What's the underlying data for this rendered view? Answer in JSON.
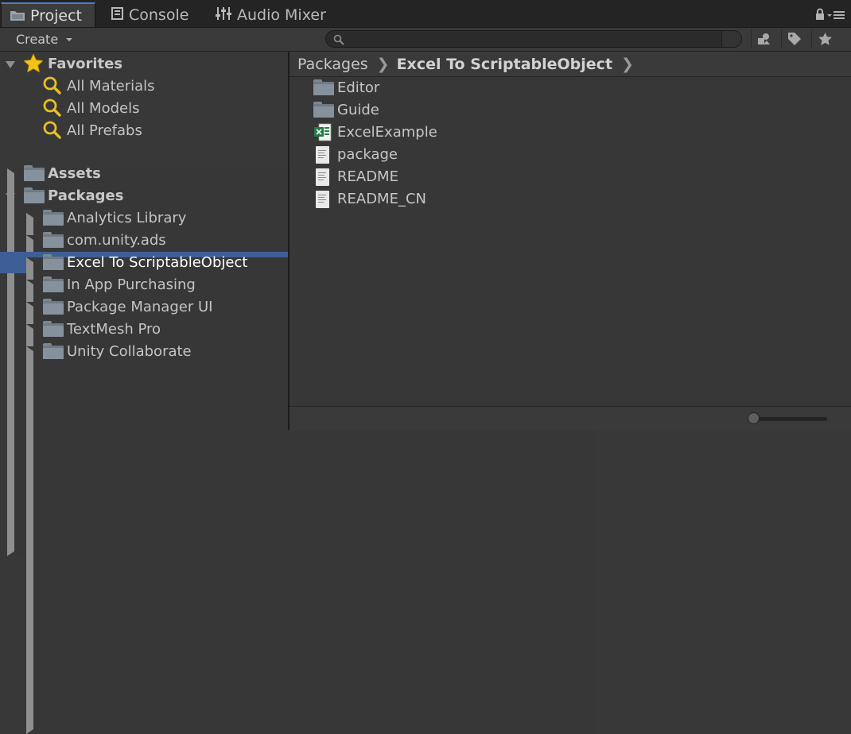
{
  "tabs": [
    {
      "label": "Project",
      "icon": "folder-icon",
      "active": true
    },
    {
      "label": "Console",
      "icon": "console-icon",
      "active": false
    },
    {
      "label": "Audio Mixer",
      "icon": "mixer-icon",
      "active": false
    }
  ],
  "toolbar": {
    "create_label": "Create",
    "search_placeholder": "",
    "icons": [
      "filter-by-type-icon",
      "filter-by-label-icon",
      "favorite-star-icon"
    ]
  },
  "favorites": {
    "label": "Favorites",
    "items": [
      "All Materials",
      "All Models",
      "All Prefabs"
    ]
  },
  "tree": {
    "assets_label": "Assets",
    "packages_label": "Packages",
    "packages": [
      "Analytics Library",
      "com.unity.ads",
      "Excel To ScriptableObject",
      "In App Purchasing",
      "Package Manager UI",
      "TextMesh Pro",
      "Unity Collaborate"
    ],
    "selected": "Excel To ScriptableObject"
  },
  "breadcrumb": [
    "Packages",
    "Excel To ScriptableObject"
  ],
  "files": [
    {
      "name": "Editor",
      "icon": "folder-icon"
    },
    {
      "name": "Guide",
      "icon": "folder-icon"
    },
    {
      "name": "ExcelExample",
      "icon": "excel-file-icon"
    },
    {
      "name": "package",
      "icon": "text-file-icon"
    },
    {
      "name": "README",
      "icon": "text-file-icon"
    },
    {
      "name": "README_CN",
      "icon": "text-file-icon"
    }
  ],
  "zoom": {
    "level": 0.0
  },
  "colors": {
    "selection": "#3e5f96",
    "active_tab_accent": "#4f7fc4",
    "favorites_star": "#f2c218",
    "search_glass": "#e8c020"
  }
}
